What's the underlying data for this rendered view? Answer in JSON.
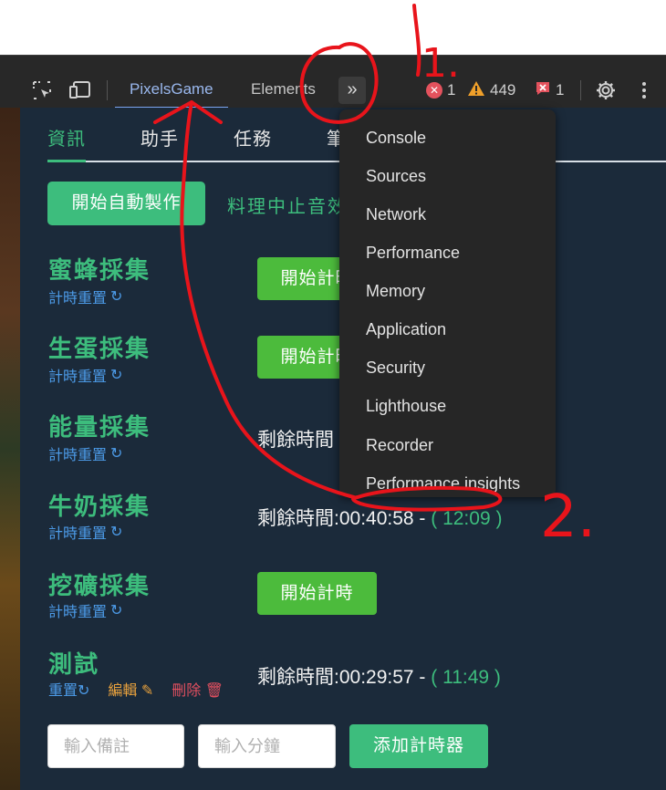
{
  "toolbar": {
    "tabs": [
      {
        "label": "PixelsGame",
        "active": true
      },
      {
        "label": "Elements",
        "active": false
      }
    ],
    "more_label": "»",
    "errors": "1",
    "warnings": "449",
    "issues": "1"
  },
  "panel": {
    "tabs": [
      "資訊",
      "助手",
      "任務",
      "筆"
    ],
    "auto_button": "開始自動製作",
    "cook_text": "料理中止音效",
    "rows": [
      {
        "title": "蜜蜂採集",
        "reset": "計時重置",
        "button": "開始計時"
      },
      {
        "title": "生蛋採集",
        "reset": "計時重置",
        "button": "開始計時"
      },
      {
        "title": "能量採集",
        "reset": "計時重置",
        "remaining_label": "剩餘時間"
      },
      {
        "title": "牛奶採集",
        "reset": "計時重置",
        "remaining_label": "剩餘時間:00:40:58 - ",
        "paren": "( 12:09 )"
      },
      {
        "title": "挖礦採集",
        "reset": "計時重置",
        "button": "開始計時"
      },
      {
        "title": "測試",
        "reset": "重置",
        "edit": "編輯",
        "delete": "刪除",
        "remaining_label": "剩餘時間:00:29:57 - ",
        "paren": "( 11:49 )"
      }
    ],
    "note_placeholder": "輸入備註",
    "minutes_placeholder": "輸入分鐘",
    "add_button": "添加計時器"
  },
  "menu": {
    "items": [
      "Console",
      "Sources",
      "Network",
      "Performance",
      "Memory",
      "Application",
      "Security",
      "Lighthouse",
      "Recorder",
      "Performance insights"
    ]
  },
  "annotations": {
    "label_1": "1.",
    "label_2": "2."
  },
  "colors": {
    "accent_green": "#3dbd7d",
    "button_green": "#4cbb3c",
    "panel_bg": "#1b2a3a",
    "link_blue": "#4c9be8",
    "annotation_red": "#e8141b"
  }
}
